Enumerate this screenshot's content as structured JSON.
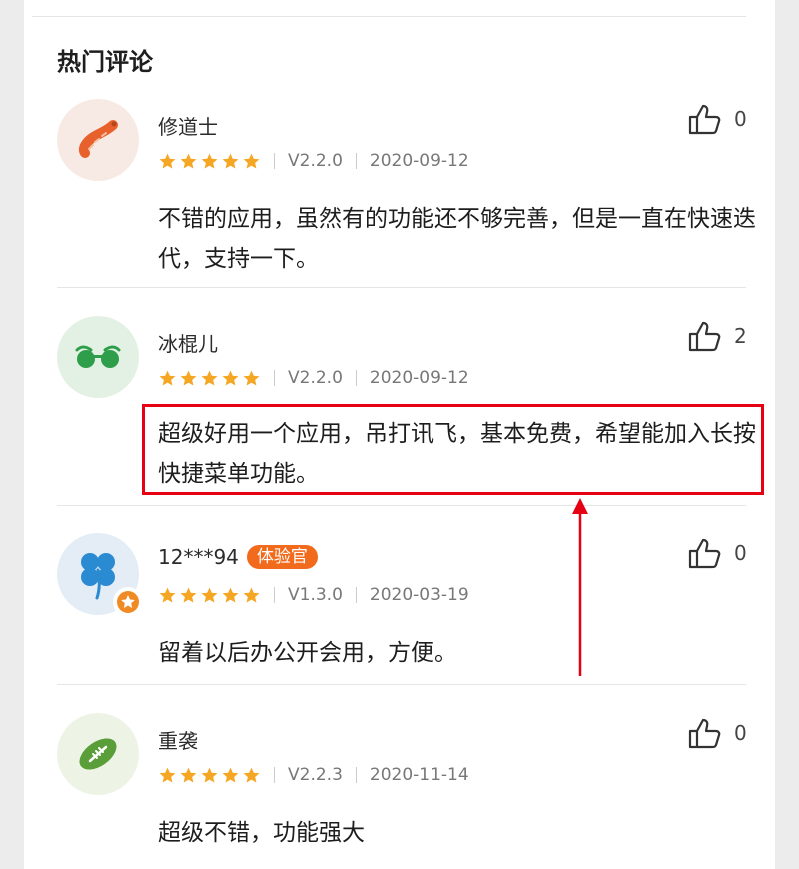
{
  "section": {
    "title": "热门评论"
  },
  "comments": [
    {
      "user": "修道士",
      "tag": "",
      "likes": "0",
      "rating": 5,
      "version": "V2.2.0",
      "date": "2020-09-12",
      "text": "不错的应用，虽然有的功能还不够完善，但是一直在快速迭代，支持一下。",
      "avatar_icon": "sausage-icon",
      "avatar_bg": "#f7e9e3"
    },
    {
      "user": "冰棍儿",
      "tag": "",
      "likes": "2",
      "rating": 5,
      "version": "V2.2.0",
      "date": "2020-09-12",
      "text": "超级好用一个应用，吊打讯飞，基本免费，希望能加入长按快捷菜单功能。",
      "avatar_icon": "sunglasses-icon",
      "avatar_bg": "#e3f1e4"
    },
    {
      "user": "12***94",
      "tag": "体验官",
      "likes": "0",
      "rating": 5,
      "version": "V1.3.0",
      "date": "2020-03-19",
      "text": "留着以后办公开会用，方便。",
      "avatar_icon": "clover-icon",
      "avatar_bg": "#e4edf6"
    },
    {
      "user": "重袭",
      "tag": "",
      "likes": "0",
      "rating": 5,
      "version": "V2.2.3",
      "date": "2020-11-14",
      "text": "超级不错，功能强大",
      "avatar_icon": "football-icon",
      "avatar_bg": "#edf4e6"
    }
  ],
  "colors": {
    "star": "#f5a623",
    "tag_bg": "#f26b1d",
    "highlight": "#e60012"
  }
}
